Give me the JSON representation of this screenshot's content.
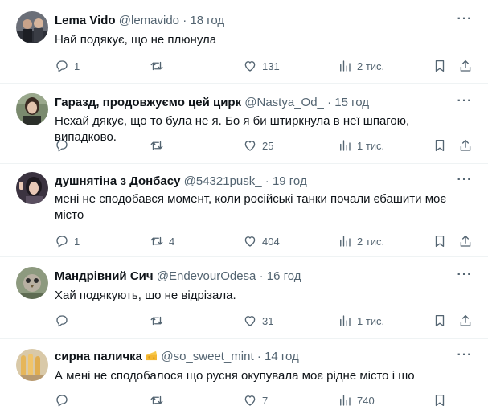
{
  "tweets": [
    {
      "name": "Lema Vido",
      "handle": "@lemavido",
      "dot": "·",
      "time": "18 год",
      "text": "Най подякує, що не плюнула",
      "replies": "1",
      "retweets": "",
      "likes": "131",
      "views": "2 тис."
    },
    {
      "name": "Гаразд, продовжуємо цей цирк",
      "handle": "@Nastya_Od_",
      "dot": "·",
      "time": "15 год",
      "text": "Нехай дякує, що то була не я. Бо я би штиркнула в неї шпагою, випадково.",
      "replies": "",
      "retweets": "",
      "likes": "25",
      "views": "1 тис."
    },
    {
      "name": "душнятіна з Донбасу",
      "handle": "@54321pusk_",
      "dot": "·",
      "time": "19 год",
      "text": "мені не сподобався момент, коли російські танки почали єбашити моє місто",
      "replies": "1",
      "retweets": "4",
      "likes": "404",
      "views": "2 тис."
    },
    {
      "name": "Мандрівний Сич",
      "handle": "@EndevourOdesa",
      "dot": "·",
      "time": "16 год",
      "text": "Хай подякують, шо не відрізала.",
      "replies": "",
      "retweets": "",
      "likes": "31",
      "views": "1 тис."
    },
    {
      "name": "сирна паличка",
      "handle": "@so_sweet_mint",
      "dot": "·",
      "time": "14 год",
      "text": "А мені не сподобалося що русня окупувала моє рідне місто і шо",
      "replies": "",
      "retweets": "",
      "likes": "7",
      "views": "740"
    }
  ],
  "icons": {
    "reply": "reply-icon",
    "retweet": "retweet-icon",
    "like": "like-icon",
    "views": "views-icon",
    "bookmark": "bookmark-icon",
    "share": "share-icon",
    "more": "more-icon",
    "name_emoji": "cheese-emoji-icon"
  },
  "colors": {
    "text": "#0f1419",
    "secondary": "#536471",
    "divider": "#eff3f4"
  }
}
